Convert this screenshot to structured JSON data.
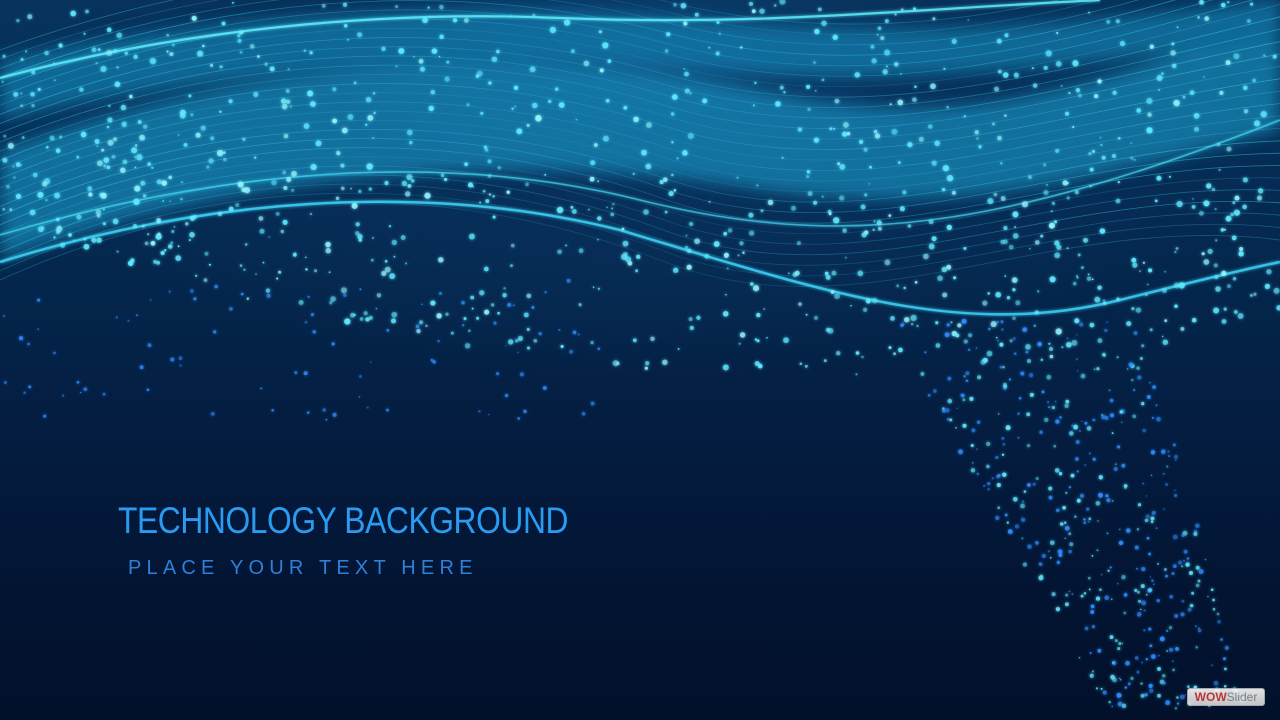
{
  "slide": {
    "headline": "TECHNOLOGY BACKGROUND",
    "subline": "PLACE YOUR TEXT HERE"
  },
  "badge": {
    "brand_part1": "WOW",
    "brand_part2": "Slider"
  },
  "colors": {
    "background_dark": "#02102a",
    "background_mid": "#06305a",
    "wave_cyan": "#37e6ff",
    "particle_cyan": "#5fe8ff",
    "particle_blue": "#2f8dff",
    "headline": "#2a9bf0",
    "subline": "#2f7fd6"
  }
}
